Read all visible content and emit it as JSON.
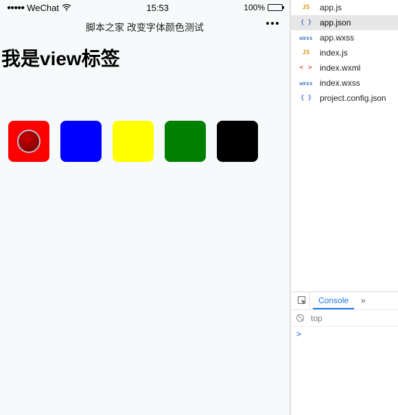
{
  "status": {
    "carrier": "WeChat",
    "time": "15:53",
    "battery_pct": "100%",
    "signal_dots": "●●●●●"
  },
  "nav": {
    "title": "脚本之家 改变字体颜色测试"
  },
  "page": {
    "heading": "我是view标签"
  },
  "swatches": [
    {
      "name": "red",
      "color": "#ff0000",
      "selected": true
    },
    {
      "name": "blue",
      "color": "#0000ff",
      "selected": false
    },
    {
      "name": "yellow",
      "color": "#ffff00",
      "selected": false
    },
    {
      "name": "green",
      "color": "#008000",
      "selected": false
    },
    {
      "name": "black",
      "color": "#000000",
      "selected": false
    }
  ],
  "files": [
    {
      "name": "app.js",
      "type": "js",
      "selected": false
    },
    {
      "name": "app.json",
      "type": "json",
      "selected": true
    },
    {
      "name": "app.wxss",
      "type": "wxss",
      "selected": false
    },
    {
      "name": "index.js",
      "type": "js",
      "selected": false
    },
    {
      "name": "index.wxml",
      "type": "wxml",
      "selected": false
    },
    {
      "name": "index.wxss",
      "type": "wxss",
      "selected": false
    },
    {
      "name": "project.config.json",
      "type": "config",
      "selected": false
    }
  ],
  "console": {
    "tab_label": "Console",
    "more_glyph": "»",
    "scope": "top",
    "prompt": ">"
  },
  "icon_labels": {
    "js": "JS",
    "json": "{ }",
    "wxss": "wxss",
    "wxml": "< >",
    "config": "{ }"
  }
}
